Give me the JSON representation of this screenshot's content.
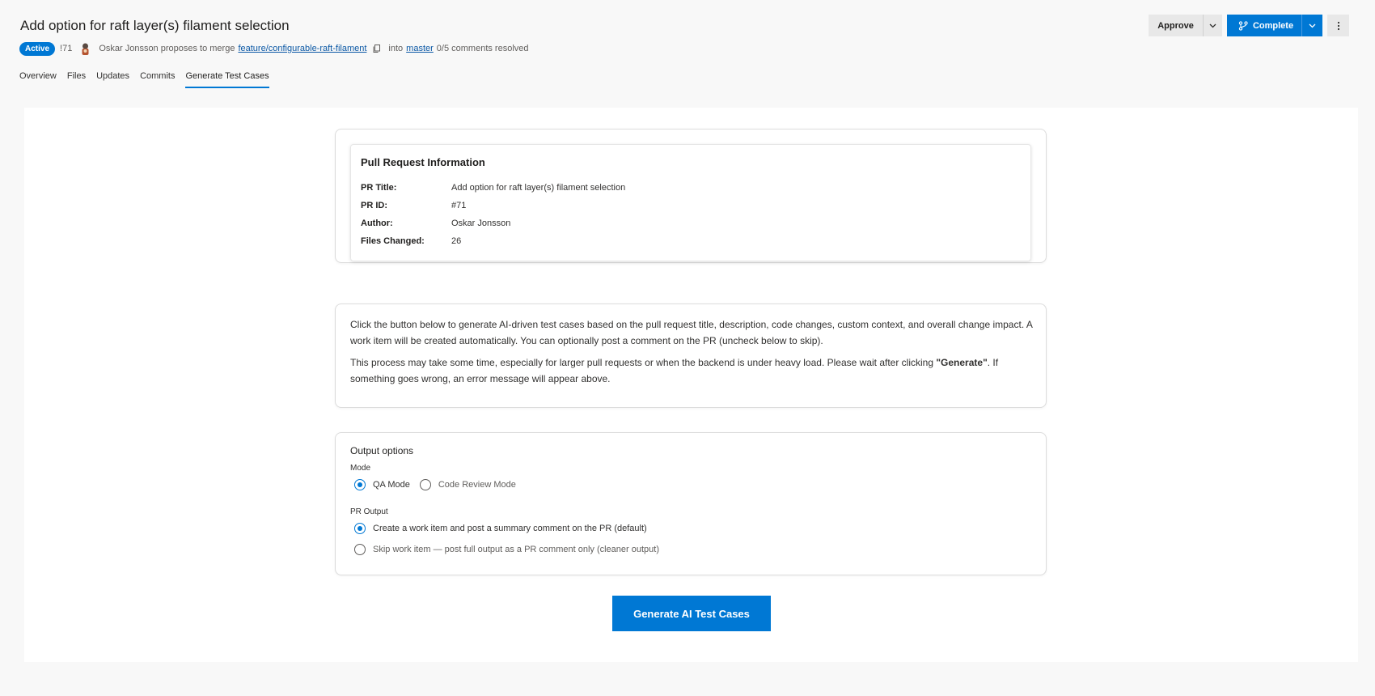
{
  "header": {
    "title": "Add option for raft layer(s) filament selection",
    "status_badge": "Active",
    "pr_number": "!71",
    "author_text": "Oskar Jonsson proposes to merge",
    "source_branch": "feature/configurable-raft-filament",
    "into_text": "into",
    "target_branch": "master",
    "comments_resolved": "0/5 comments resolved"
  },
  "actions": {
    "approve_label": "Approve",
    "complete_label": "Complete"
  },
  "tabs": [
    {
      "label": "Overview"
    },
    {
      "label": "Files"
    },
    {
      "label": "Updates"
    },
    {
      "label": "Commits"
    },
    {
      "label": "Generate Test Cases",
      "active": true
    }
  ],
  "pr_info": {
    "title": "Pull Request Information",
    "rows": [
      {
        "label": "PR Title:",
        "value": "Add option for raft layer(s) filament selection"
      },
      {
        "label": "PR ID:",
        "value": "#71"
      },
      {
        "label": "Author:",
        "value": "Oskar Jonsson"
      },
      {
        "label": "Files Changed:",
        "value": "26"
      }
    ]
  },
  "description": {
    "para1": "Click the button below to generate AI-driven test cases based on the pull request title, description, code changes, custom context, and overall change impact. A work item will be created automatically. You can optionally post a comment on the PR (uncheck below to skip).",
    "para2_before": "This process may take some time, especially for larger pull requests or when the backend is under heavy load. Please wait after clicking ",
    "para2_bold": "\"Generate\"",
    "para2_after": ". If something goes wrong, an error message will appear above."
  },
  "output_options": {
    "title": "Output options",
    "mode_label": "Mode",
    "mode_options": [
      {
        "label": "QA Mode",
        "checked": true
      },
      {
        "label": "Code Review Mode",
        "checked": false
      }
    ],
    "pr_output_label": "PR Output",
    "pr_output_options": [
      {
        "label": "Create a work item and post a summary comment on the PR (default)",
        "checked": true
      },
      {
        "label": "Skip work item — post full output as a PR comment only (cleaner output)",
        "checked": false
      }
    ]
  },
  "generate_button": "Generate AI Test Cases",
  "colors": {
    "accent": "#0078d4",
    "link": "#0b58a5",
    "page_bg": "#f8f8f8"
  }
}
